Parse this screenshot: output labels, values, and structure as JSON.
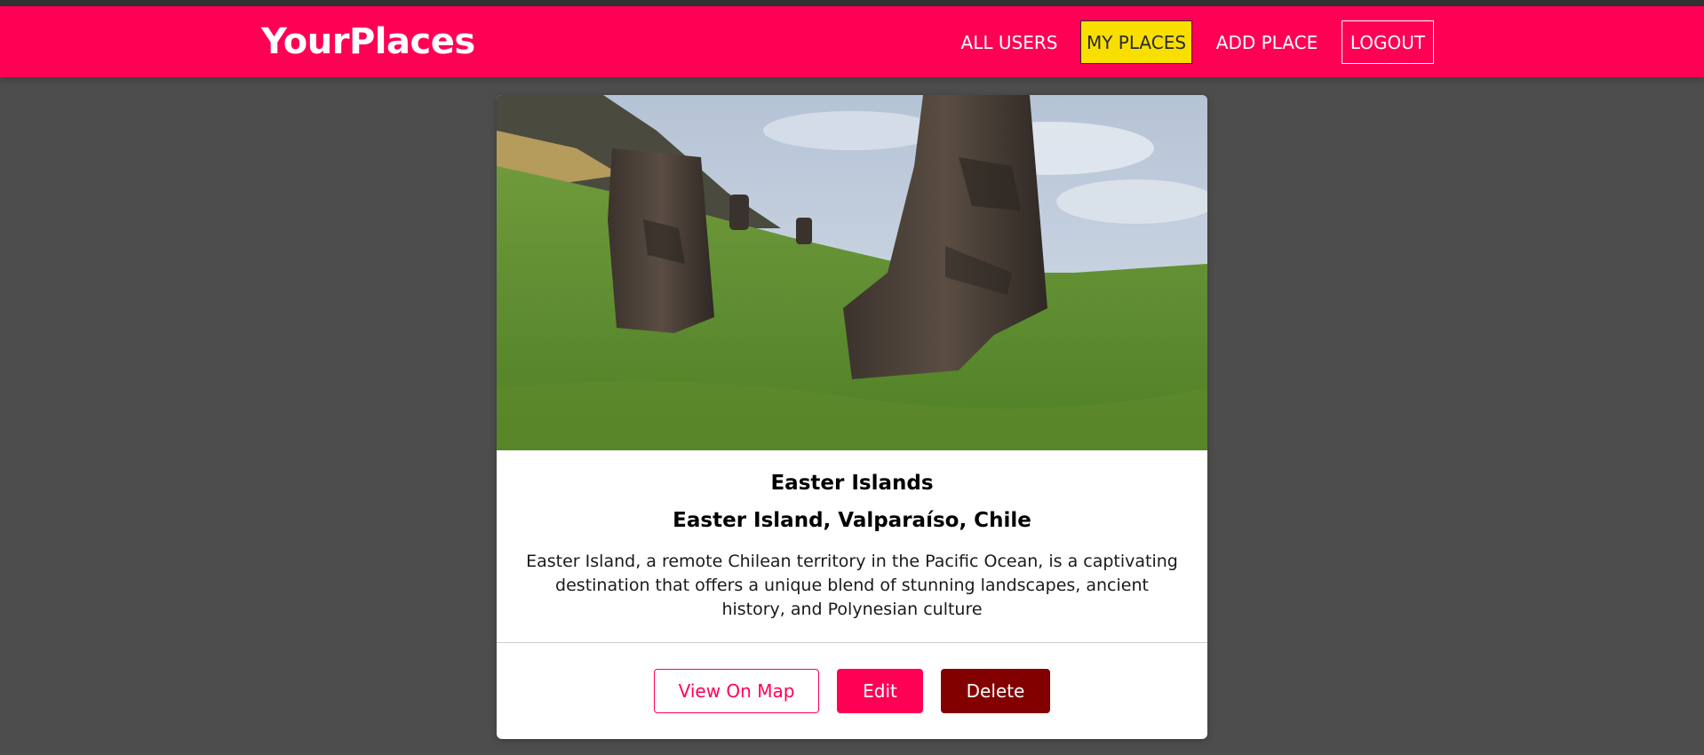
{
  "app": {
    "logo": "YourPlaces"
  },
  "nav": {
    "items": [
      {
        "label": "ALL USERS"
      },
      {
        "label": "MY PLACES"
      },
      {
        "label": "ADD PLACE"
      },
      {
        "label": "LOGOUT"
      }
    ],
    "active": "MY PLACES"
  },
  "place": {
    "title": "Easter Islands",
    "address": "Easter Island, Valparaíso, Chile",
    "description": "Easter Island, a remote Chilean territory in the Pacific Ocean, is a captivating destination that offers a unique blend of stunning landscapes, ancient history, and Polynesian culture",
    "image_subject": "moai-statues-photo"
  },
  "actions": {
    "view_on_map": "View On Map",
    "edit": "Edit",
    "delete": "Delete"
  },
  "colors": {
    "brand": "#ff0055",
    "active_nav": "#f8df00",
    "danger": "#830000",
    "background": "#4d4d4d"
  }
}
